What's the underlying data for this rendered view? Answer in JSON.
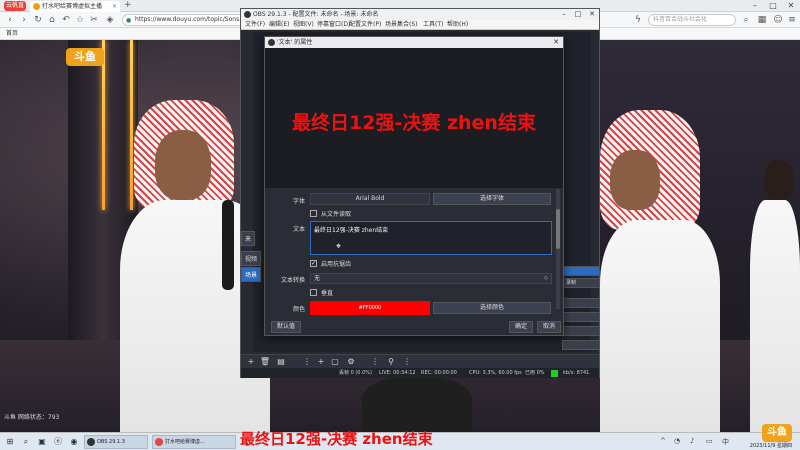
{
  "browser": {
    "logo_text": "云帆直播",
    "tab_title": "打水吧给赛博虚拟主播",
    "address": "https://www.douyu.com/topic/Sons...",
    "search_placeholder": "抖音百合战斗社会化",
    "bookmark": "首页"
  },
  "stage": {
    "logo_text": "斗鱼",
    "stream_stat": "斗鱼 网络状态：793"
  },
  "obs": {
    "title": "OBS 29.1.3 - 配置文件: 未命名 - 场景: 未命名",
    "menu": [
      "文件(F)",
      "编辑(E)",
      "视图(V)",
      "停靠窗口(D)",
      "配置文件(P)",
      "场景集合(S)",
      "工具(T)",
      "帮助(H)"
    ],
    "side_tabs": [
      "来",
      "视频",
      "场景"
    ],
    "right_dock": [
      "",
      "录制",
      "",
      "",
      "",
      "",
      "",
      ""
    ],
    "status": {
      "frames": "丢帧 0 (0.0%)",
      "live": "LIVE: 00:34:12",
      "rec": "REC: 00:00:00",
      "cpu": "CPU: 3.3%, 60.00 fps",
      "disk": "已用 0%",
      "kbps": "kb/s: 8741"
    }
  },
  "dialog": {
    "title": "'文本' 的属性",
    "overlay_text": "最终日12强-决赛 zhen结束",
    "labels": {
      "font": "字体",
      "text": "文本",
      "text_transform": "文本转换",
      "color": "颜色"
    },
    "font_value": "Arial Bold",
    "select_font_button": "选择字体",
    "from_file_label": "从文件读取",
    "text_value": "最终日12强-决赛 zhen结束",
    "antialias_label": "启用抗锯齿",
    "transform_value": "无",
    "vertical_label": "垂直",
    "color_value": "#FF0000",
    "select_color_button": "选择颜色",
    "defaults_button": "默认值",
    "ok_button": "确定",
    "cancel_button": "取消"
  },
  "taskbar": {
    "apps": [
      "OBS 29.1.3",
      "打水吧给赛博虚..."
    ],
    "overlay_text": "最终日12强-决赛 zhen结束",
    "time": "13:50",
    "date": "2023/11/9 星期四",
    "corner_logo": "斗鱼"
  },
  "colors": {
    "overlay_red": "#EE1111",
    "accent_blue": "#2C6BBF",
    "status_green": "#22CC22"
  }
}
